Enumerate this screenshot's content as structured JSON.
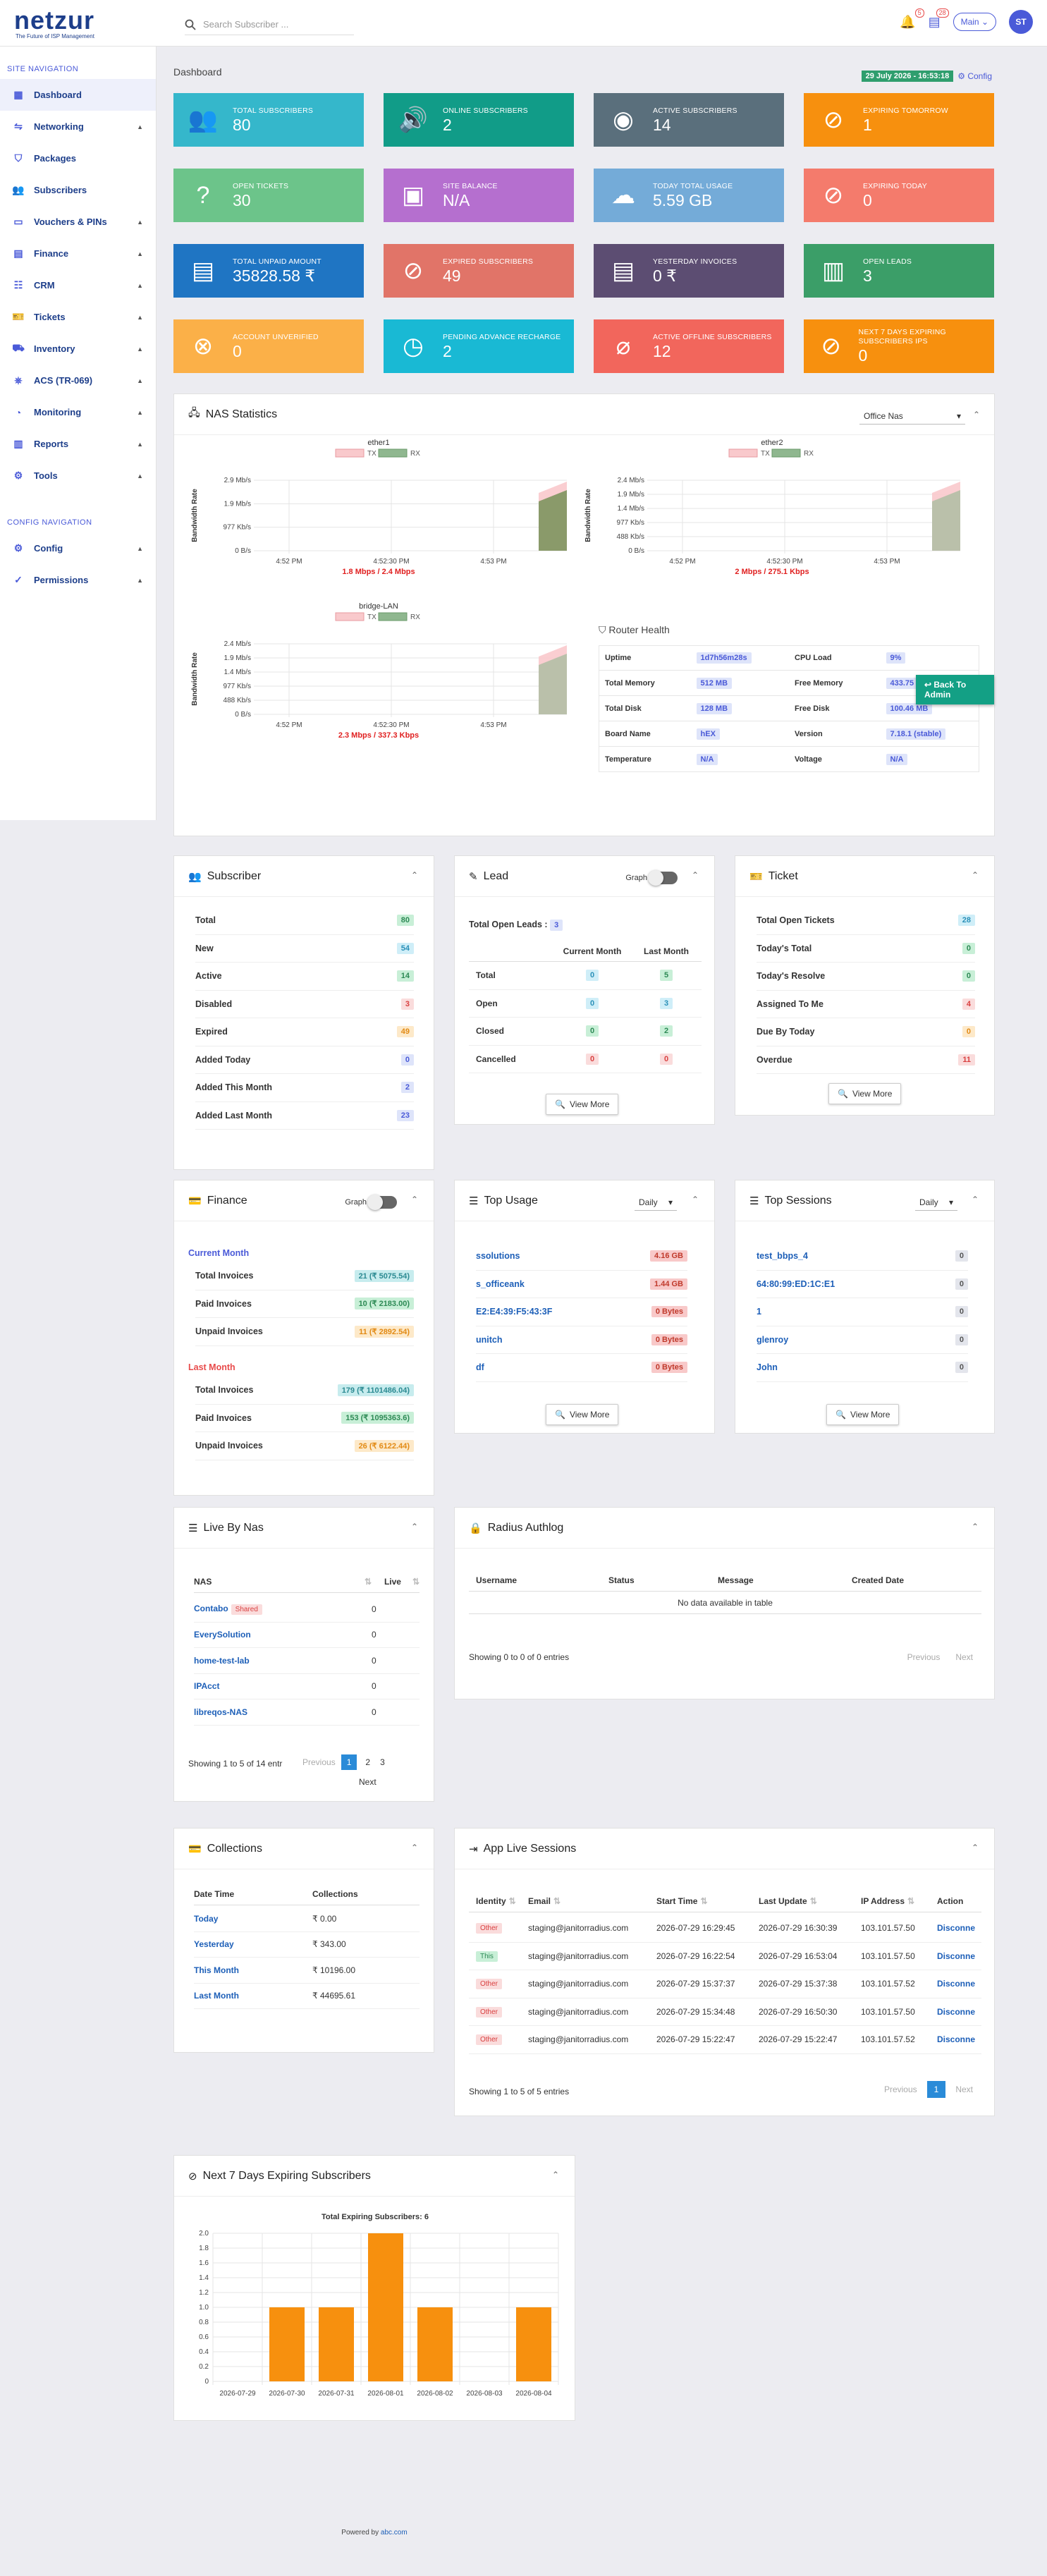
{
  "brand": {
    "logo": "netzur",
    "tagline": "The Future of ISP Management"
  },
  "search": {
    "placeholder": "Search Subscriber ..."
  },
  "topbar": {
    "notif1_count": "5",
    "notif2_count": "28",
    "main_label": "Main",
    "avatar": "ST"
  },
  "sidebar": {
    "site_title": "SITE NAVIGATION",
    "items": [
      {
        "label": "Dashboard",
        "icon": "dashboard-icon",
        "arrow": false
      },
      {
        "label": "Networking",
        "icon": "network-icon",
        "arrow": true
      },
      {
        "label": "Packages",
        "icon": "tag-icon",
        "arrow": false
      },
      {
        "label": "Subscribers",
        "icon": "users-icon",
        "arrow": false
      },
      {
        "label": "Vouchers & PINs",
        "icon": "voucher-icon",
        "arrow": true
      },
      {
        "label": "Finance",
        "icon": "finance-icon",
        "arrow": true
      },
      {
        "label": "CRM",
        "icon": "crm-icon",
        "arrow": true
      },
      {
        "label": "Tickets",
        "icon": "ticket-icon",
        "arrow": true
      },
      {
        "label": "Inventory",
        "icon": "inventory-icon",
        "arrow": true
      },
      {
        "label": "ACS (TR-069)",
        "icon": "acs-icon",
        "arrow": true
      },
      {
        "label": "Monitoring",
        "icon": "monitoring-icon",
        "arrow": true
      },
      {
        "label": "Reports",
        "icon": "reports-icon",
        "arrow": true
      },
      {
        "label": "Tools",
        "icon": "tools-icon",
        "arrow": true
      }
    ],
    "config_title": "CONFIG NAVIGATION",
    "config_items": [
      {
        "label": "Config",
        "icon": "config-icon",
        "arrow": true
      },
      {
        "label": "Permissions",
        "icon": "permissions-icon",
        "arrow": true
      }
    ]
  },
  "header": {
    "breadcrumb": "Dashboard",
    "date": "29 July 2026 - 16:53:18",
    "config_label": "Config"
  },
  "tiles": [
    {
      "label": "Total Subscribers",
      "value": "80",
      "color": "#35b7cb",
      "icon": "users-icon"
    },
    {
      "label": "Online Subscribers",
      "value": "2",
      "color": "#119c88",
      "icon": "online-user-icon"
    },
    {
      "label": "Active Subscribers",
      "value": "14",
      "color": "#5a6f7c",
      "icon": "user-circle-icon"
    },
    {
      "label": "Expiring Tomorrow",
      "value": "1",
      "color": "#f7900e",
      "icon": "user-off-icon"
    },
    {
      "label": "Open Tickets",
      "value": "30",
      "color": "#6cc48a",
      "icon": "question-icon"
    },
    {
      "label": "Site Balance",
      "value": "N/A",
      "color": "#b56fcf",
      "icon": "wallet-icon"
    },
    {
      "label": "Today Total Usage",
      "value": "5.59 GB",
      "color": "#74abd8",
      "icon": "cloud-download-icon"
    },
    {
      "label": "Expiring Today",
      "value": "0",
      "color": "#f47b6c",
      "icon": "user-off-icon"
    },
    {
      "label": "Total Unpaid Amount",
      "value": "35828.58 ₹",
      "color": "#1f75c3",
      "icon": "money-icon"
    },
    {
      "label": "Expired Subscribers",
      "value": "49",
      "color": "#e17468",
      "icon": "user-off-icon"
    },
    {
      "label": "Yesterday Invoices",
      "value": "0 ₹",
      "color": "#5c4d72",
      "icon": "invoice-icon"
    },
    {
      "label": "Open Leads",
      "value": "3",
      "color": "#3b9e68",
      "icon": "bar-chart-icon"
    },
    {
      "label": "Account Unverified",
      "value": "0",
      "color": "#fbb048",
      "icon": "x-circle-icon"
    },
    {
      "label": "Pending Advance Recharge",
      "value": "2",
      "color": "#19b9d4",
      "icon": "clock-icon"
    },
    {
      "label": "Active Offline Subscribers",
      "value": "12",
      "color": "#f2665c",
      "icon": "wifi-off-icon"
    },
    {
      "label": "Next 7 Days Expiring Subscribers IPS",
      "value": "0",
      "color": "#f7900e",
      "icon": "user-off-icon"
    }
  ],
  "nas": {
    "title": "NAS Statistics",
    "select": "Office Nas",
    "graphs": [
      {
        "title": "ether1",
        "summary": "1.8 Mbps / 2.4 Mbps",
        "yticks": [
          "2.9 Mb/s",
          "1.9 Mb/s",
          "977 Kb/s",
          "0 B/s"
        ],
        "ymax": 2.9
      },
      {
        "title": "ether2",
        "summary": "2 Mbps / 275.1 Kbps",
        "yticks": [
          "2.4 Mb/s",
          "1.9 Mb/s",
          "1.4 Mb/s",
          "977 Kb/s",
          "488 Kb/s",
          "0 B/s"
        ],
        "ymax": 2.4
      },
      {
        "title": "bridge-LAN",
        "summary": "2.3 Mbps / 337.3 Kbps",
        "yticks": [
          "2.4 Mb/s",
          "1.9 Mb/s",
          "1.4 Mb/s",
          "977 Kb/s",
          "488 Kb/s",
          "0 B/s"
        ],
        "ymax": 2.4
      }
    ],
    "xticks": [
      "4:52 PM",
      "4:52:30 PM",
      "4:53 PM"
    ],
    "legend_tx": "TX",
    "legend_rx": "RX",
    "ylabel": "Bandwidth Rate",
    "router_title": "Router Health",
    "router": [
      [
        "Uptime",
        "1d7h56m28s",
        "CPU Load",
        "9%"
      ],
      [
        "Total Memory",
        "512 MB",
        "Free Memory",
        "433.75 MB"
      ],
      [
        "Total Disk",
        "128 MB",
        "Free Disk",
        "100.46 MB"
      ],
      [
        "Board Name",
        "hEX",
        "Version",
        "7.18.1 (stable)"
      ],
      [
        "Temperature",
        "N/A",
        "Voltage",
        "N/A"
      ]
    ],
    "back_admin": "Back To Admin"
  },
  "subscriber": {
    "title": "Subscriber",
    "rows": [
      [
        "Total",
        "80"
      ],
      [
        "New",
        "54"
      ],
      [
        "Active",
        "14"
      ],
      [
        "Disabled",
        "3"
      ],
      [
        "Expired",
        "49"
      ],
      [
        "Added Today",
        "0"
      ],
      [
        "Added This Month",
        "2"
      ],
      [
        "Added Last Month",
        "23"
      ]
    ]
  },
  "lead": {
    "title": "Lead",
    "graph": "Graph",
    "open_label": "Total Open Leads :",
    "open_value": "3",
    "col1": "Current Month",
    "col2": "Last Month",
    "rows": [
      [
        "Total",
        "0",
        "5"
      ],
      [
        "Open",
        "0",
        "3"
      ],
      [
        "Closed",
        "0",
        "2"
      ],
      [
        "Cancelled",
        "0",
        "0"
      ]
    ],
    "view_more": "View More"
  },
  "ticket": {
    "title": "Ticket",
    "rows": [
      [
        "Total Open Tickets",
        "28"
      ],
      [
        "Today's Total",
        "0"
      ],
      [
        "Today's Resolve",
        "0"
      ],
      [
        "Assigned To Me",
        "4"
      ],
      [
        "Due By Today",
        "0"
      ],
      [
        "Overdue",
        "11"
      ]
    ],
    "view_more": "View More"
  },
  "finance": {
    "title": "Finance",
    "graph": "Graph",
    "current": "Current Month",
    "last": "Last Month",
    "current_rows": [
      [
        "Total Invoices",
        "21 (₹ 5075.54)"
      ],
      [
        "Paid Invoices",
        "10 (₹ 2183.00)"
      ],
      [
        "Unpaid Invoices",
        "11 (₹ 2892.54)"
      ]
    ],
    "last_rows": [
      [
        "Total Invoices",
        "179 (₹ 1101486.04)"
      ],
      [
        "Paid Invoices",
        "153 (₹ 1095363.6)"
      ],
      [
        "Unpaid Invoices",
        "26 (₹ 6122.44)"
      ]
    ]
  },
  "top_usage": {
    "title": "Top Usage",
    "select": "Daily",
    "rows": [
      [
        "ssolutions",
        "4.16 GB"
      ],
      [
        "s_officeank",
        "1.44 GB"
      ],
      [
        "E2:E4:39:F5:43:3F",
        "0 Bytes"
      ],
      [
        "unitch",
        "0 Bytes"
      ],
      [
        "df",
        "0 Bytes"
      ]
    ],
    "view_more": "View More"
  },
  "top_sessions": {
    "title": "Top Sessions",
    "select": "Daily",
    "rows": [
      [
        "test_bbps_4",
        "0"
      ],
      [
        "64:80:99:ED:1C:E1",
        "0"
      ],
      [
        "1",
        "0"
      ],
      [
        "glenroy",
        "0"
      ],
      [
        "John",
        "0"
      ]
    ],
    "view_more": "View More"
  },
  "live_nas": {
    "title": "Live By Nas",
    "col1": "NAS",
    "col2": "Live",
    "shared": "Shared",
    "rows": [
      [
        "Contabo",
        "0"
      ],
      [
        "EverySolution",
        "0"
      ],
      [
        "home-test-lab",
        "0"
      ],
      [
        "IPAcct",
        "0"
      ],
      [
        "libreqos-NAS",
        "0"
      ]
    ],
    "info": "Showing 1 to 5 of 14 entr",
    "prev": "Previous",
    "pages": [
      "1",
      "2",
      "3"
    ],
    "next": "Next"
  },
  "radius": {
    "title": "Radius Authlog",
    "cols": [
      "Username",
      "Status",
      "Message",
      "Created Date"
    ],
    "empty": "No data available in table",
    "info": "Showing 0 to 0 of 0 entries",
    "prev": "Previous",
    "next": "Next"
  },
  "collections": {
    "title": "Collections",
    "col1": "Date Time",
    "col2": "Collections",
    "rows": [
      [
        "Today",
        "₹ 0.00"
      ],
      [
        "Yesterday",
        "₹ 343.00"
      ],
      [
        "This Month",
        "₹ 10196.00"
      ],
      [
        "Last Month",
        "₹ 44695.61"
      ]
    ]
  },
  "app_sessions": {
    "title": "App Live Sessions",
    "cols": [
      "Identity",
      "Email",
      "Start Time",
      "Last Update",
      "IP Address",
      "Action"
    ],
    "rows": [
      [
        "Other",
        "staging@janitorradius.com",
        "2026-07-29 16:29:45",
        "2026-07-29 16:30:39",
        "103.101.57.50",
        "Disconne"
      ],
      [
        "This",
        "staging@janitorradius.com",
        "2026-07-29 16:22:54",
        "2026-07-29 16:53:04",
        "103.101.57.50",
        "Disconne"
      ],
      [
        "Other",
        "staging@janitorradius.com",
        "2026-07-29 15:37:37",
        "2026-07-29 15:37:38",
        "103.101.57.52",
        "Disconne"
      ],
      [
        "Other",
        "staging@janitorradius.com",
        "2026-07-29 15:34:48",
        "2026-07-29 16:50:30",
        "103.101.57.50",
        "Disconne"
      ],
      [
        "Other",
        "staging@janitorradius.com",
        "2026-07-29 15:22:47",
        "2026-07-29 15:22:47",
        "103.101.57.52",
        "Disconne"
      ]
    ],
    "info": "Showing 1 to 5 of 5 entries",
    "prev": "Previous",
    "page": "1",
    "next": "Next"
  },
  "expiring": {
    "title": "Next 7 Days Expiring Subscribers"
  },
  "chart_data": {
    "type": "bar",
    "title": "Total Expiring Subscribers: 6",
    "categories": [
      "2026-07-29",
      "2026-07-30",
      "2026-07-31",
      "2026-08-01",
      "2026-08-02",
      "2026-08-03",
      "2026-08-04"
    ],
    "values": [
      0,
      1,
      1,
      2,
      1,
      0,
      1
    ],
    "ylim": [
      0,
      2.0
    ],
    "yticks": [
      "2.0",
      "1.8",
      "1.6",
      "1.4",
      "1.2",
      "1.0",
      "0.8",
      "0.6",
      "0.4",
      "0.2",
      "0"
    ],
    "color": "#f7900e",
    "grid": true
  },
  "footer": {
    "powered": "Powered by",
    "company": "abc.com"
  }
}
